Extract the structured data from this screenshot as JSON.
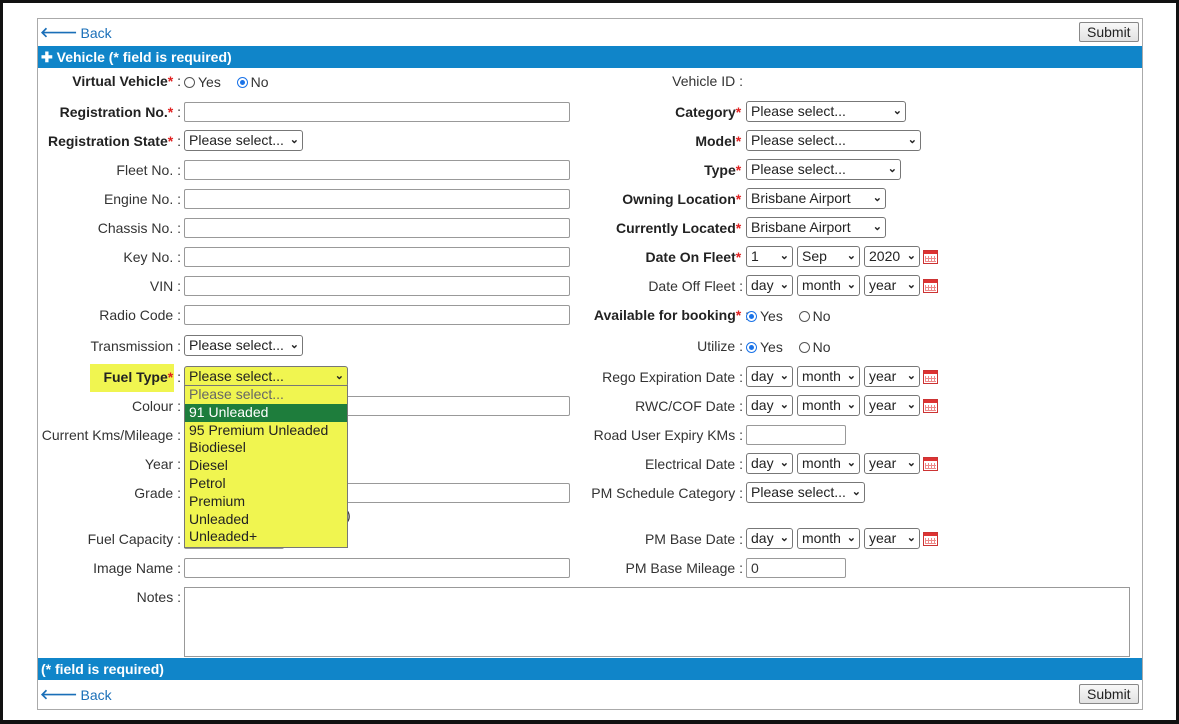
{
  "nav": {
    "back": "Back",
    "submit": "Submit"
  },
  "section": {
    "header": "Vehicle (* field is required)",
    "footer": "(* field is required)"
  },
  "left": {
    "virtual_vehicle": {
      "label": "Virtual Vehicle",
      "yes": "Yes",
      "no": "No"
    },
    "registration_no": "Registration No.",
    "registration_state": {
      "label": "Registration State",
      "value": "Please select..."
    },
    "fleet_no": "Fleet No.",
    "engine_no": "Engine No.",
    "chassis_no": "Chassis No.",
    "key_no": "Key No.",
    "vin": "VIN",
    "radio_code": "Radio Code",
    "transmission": {
      "label": "Transmission",
      "value": "Please select..."
    },
    "fuel_type": {
      "label": "Fuel Type",
      "value": "Please select...",
      "options": [
        "Please select...",
        "91 Unleaded",
        "95 Premium Unleaded",
        "Biodiesel",
        "Diesel",
        "Petrol",
        "Premium",
        "Unleaded",
        "Unleaded+"
      ],
      "highlighted": "91 Unleaded"
    },
    "colour": "Colour",
    "current_kms": "Current Kms/Mileage",
    "year": "Year",
    "grade": "Grade",
    "fuel_capacity": "Fuel Capacity",
    "image_name": "Image Name",
    "notes": "Notes"
  },
  "right": {
    "vehicle_id": "Vehicle ID :",
    "category": {
      "label": "Category",
      "value": "Please select..."
    },
    "model": {
      "label": "Model",
      "value": "Please select..."
    },
    "type": {
      "label": "Type",
      "value": "Please select..."
    },
    "owning_location": {
      "label": "Owning Location",
      "value": "Brisbane Airport"
    },
    "currently_located": {
      "label": "Currently Located",
      "value": "Brisbane Airport"
    },
    "date_on_fleet": {
      "label": "Date On Fleet",
      "day": "1",
      "month": "Sep",
      "year": "2020"
    },
    "date_off_fleet": {
      "label": "Date Off Fleet",
      "day": "day",
      "month": "month",
      "year": "year"
    },
    "available_for_booking": {
      "label": "Available for booking",
      "yes": "Yes",
      "no": "No"
    },
    "utilize": {
      "label": "Utilize",
      "yes": "Yes",
      "no": "No"
    },
    "rego_expiration": {
      "label": "Rego Expiration Date",
      "day": "day",
      "month": "month",
      "year": "year"
    },
    "rwc_cof": {
      "label": "RWC/COF Date",
      "day": "day",
      "month": "month",
      "year": "year"
    },
    "road_user_expiry": "Road User Expiry KMs",
    "electrical_date": {
      "label": "Electrical Date",
      "day": "day",
      "month": "month",
      "year": "year"
    },
    "pm_schedule_category": {
      "label": "PM Schedule Category",
      "value": "Please select..."
    },
    "pm_base_date": {
      "label": "PM Base Date",
      "day": "day",
      "month": "month",
      "year": "year"
    },
    "pm_base_mileage": {
      "label": "PM Base Mileage",
      "value": "0"
    }
  },
  "colors": {
    "accent": "#1085c9",
    "highlight": "#f0f550",
    "selected_option": "#1e7d3c",
    "required": "#e02020"
  },
  "icons": {
    "back": "left-arrow-icon",
    "section": "plus-icon",
    "calendar": "calendar-icon",
    "dropdown": "chevron-down-icon"
  }
}
